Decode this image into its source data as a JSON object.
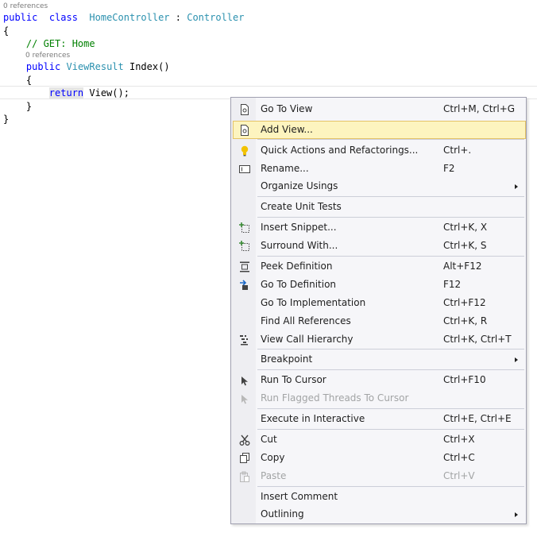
{
  "code": {
    "lens_class": "0 references",
    "lens_method": "0 references",
    "lines": [
      {
        "t": [
          [
            "kw",
            "public"
          ],
          [
            "",
            "  "
          ],
          [
            "kw",
            "class"
          ],
          [
            "",
            "  "
          ],
          [
            "ty",
            "HomeController"
          ],
          [
            "",
            " : "
          ],
          [
            "ty",
            "Controller"
          ]
        ]
      },
      {
        "t": [
          [
            "",
            "{"
          ]
        ]
      },
      {
        "t": [
          [
            "",
            "    "
          ],
          [
            "cm",
            "// GET: Home"
          ]
        ]
      },
      {
        "t": [
          [
            "",
            "    "
          ],
          [
            "kw",
            "public"
          ],
          [
            "",
            " "
          ],
          [
            "ty",
            "ViewResult"
          ],
          [
            "",
            " Index()"
          ]
        ]
      },
      {
        "t": [
          [
            "",
            "    {"
          ]
        ]
      },
      {
        "t": [
          [
            "",
            "        "
          ],
          [
            "kw",
            "return"
          ],
          [
            "",
            " View();"
          ]
        ]
      },
      {
        "t": [
          [
            "",
            "    }"
          ]
        ]
      },
      {
        "t": [
          [
            "",
            "}"
          ]
        ]
      }
    ],
    "colors": {
      "keyword": "#0000ff",
      "type": "#2b91af",
      "comment": "#008000"
    }
  },
  "menu": {
    "items": [
      {
        "label": "Go To View",
        "shortcut": "Ctrl+M, Ctrl+G",
        "icon": "go-to-view-icon"
      },
      {
        "label": "Add View...",
        "shortcut": "",
        "icon": "add-view-icon",
        "hover": true
      },
      {
        "label": "Quick Actions and Refactorings...",
        "shortcut": "Ctrl+.",
        "icon": "lightbulb-icon"
      },
      {
        "label": "Rename...",
        "shortcut": "F2",
        "icon": "rename-icon"
      },
      {
        "label": "Organize Usings",
        "shortcut": "",
        "submenu": true
      },
      {
        "label": "Create Unit Tests",
        "shortcut": ""
      },
      {
        "label": "Insert Snippet...",
        "shortcut": "Ctrl+K, X",
        "icon": "insert-snippet-icon"
      },
      {
        "label": "Surround With...",
        "shortcut": "Ctrl+K, S",
        "icon": "surround-with-icon"
      },
      {
        "label": "Peek Definition",
        "shortcut": "Alt+F12",
        "icon": "peek-definition-icon"
      },
      {
        "label": "Go To Definition",
        "shortcut": "F12",
        "icon": "go-to-definition-icon"
      },
      {
        "label": "Go To Implementation",
        "shortcut": "Ctrl+F12"
      },
      {
        "label": "Find All References",
        "shortcut": "Ctrl+K, R"
      },
      {
        "label": "View Call Hierarchy",
        "shortcut": "Ctrl+K, Ctrl+T",
        "icon": "call-hierarchy-icon"
      },
      {
        "label": "Breakpoint",
        "shortcut": "",
        "submenu": true
      },
      {
        "label": "Run To Cursor",
        "shortcut": "Ctrl+F10",
        "icon": "cursor-arrow-icon"
      },
      {
        "label": "Run Flagged Threads To Cursor",
        "shortcut": "",
        "icon": "cursor-arrow-icon",
        "disabled": true
      },
      {
        "label": "Execute in Interactive",
        "shortcut": "Ctrl+E, Ctrl+E"
      },
      {
        "label": "Cut",
        "shortcut": "Ctrl+X",
        "icon": "scissors-icon"
      },
      {
        "label": "Copy",
        "shortcut": "Ctrl+C",
        "icon": "copy-icon"
      },
      {
        "label": "Paste",
        "shortcut": "Ctrl+V",
        "icon": "paste-icon",
        "disabled": true
      },
      {
        "label": "Insert Comment",
        "shortcut": ""
      },
      {
        "label": "Outlining",
        "shortcut": "",
        "submenu": true
      }
    ],
    "colors": {
      "hover_bg": "#fdf4bf",
      "hover_border": "#e5c365",
      "disabled_text": "#a2a4a5"
    }
  }
}
